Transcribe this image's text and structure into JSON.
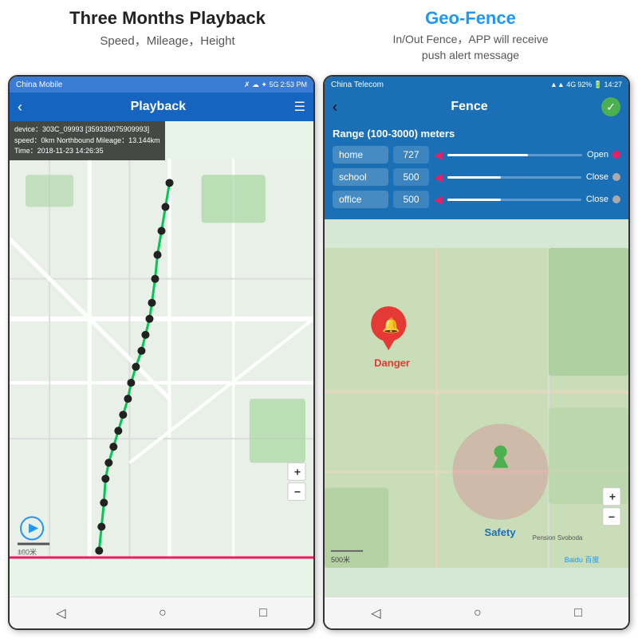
{
  "left_section": {
    "title": "Three Months Playback",
    "subtitle": "Speed，Mileage，Height"
  },
  "right_section": {
    "title": "Geo-Fence",
    "subtitle": "In/Out Fence，APP will receive\npush alert message"
  },
  "phone_left": {
    "status_bar": {
      "carrier": "China Mobile",
      "time": "2:53 PM",
      "icons": "✗ ☁ ✦ 5G"
    },
    "app_bar": {
      "title": "Playback",
      "back": "‹",
      "menu": "☰"
    },
    "info": {
      "device": "device：303C_09993 [359339075909993]",
      "speed": "speed：0km  Northbound  Mileage：13.144km",
      "time": "Time：2018-11-23 14:26:35"
    },
    "nav": {
      "back": "◁",
      "home": "○",
      "square": "□"
    }
  },
  "phone_right": {
    "status_bar": {
      "carrier": "China Telecom",
      "time": "14:27",
      "battery": "92%"
    },
    "app_bar": {
      "title": "Fence",
      "back": "‹"
    },
    "fence": {
      "range_label": "Range (100-3000) meters",
      "rows": [
        {
          "name": "home",
          "value": "727",
          "status": "Open",
          "active": true
        },
        {
          "name": "school",
          "value": "500",
          "status": "Close",
          "active": false
        },
        {
          "name": "office",
          "value": "500",
          "status": "Close",
          "active": false
        }
      ]
    },
    "map": {
      "danger_label": "Danger",
      "safety_label": "Safety",
      "scale": "500米",
      "zoom_plus": "+",
      "zoom_minus": "−"
    },
    "nav": {
      "back": "◁",
      "home": "○",
      "square": "□"
    }
  }
}
